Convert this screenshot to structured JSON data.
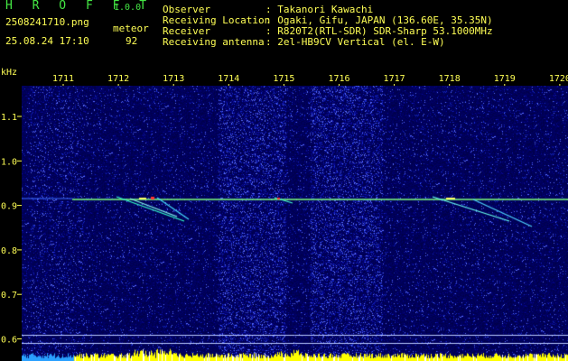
{
  "app": {
    "logo": "H R O F F T",
    "version": "1.0.0"
  },
  "file": {
    "name": "2508241710.png",
    "datetime": "25.08.24 17:10"
  },
  "detection": {
    "label": "meteor",
    "count": "92"
  },
  "station": {
    "rows": [
      {
        "label": "Observer",
        "value": ": Takanori Kawachi"
      },
      {
        "label": "Receiving Location",
        "value": ": Ogaki, Gifu, JAPAN (136.60E, 35.35N)"
      },
      {
        "label": "Receiver",
        "value": ": R820T2(RTL-SDR) SDR-Sharp 53.1000MHz"
      },
      {
        "label": "Receiving antenna",
        "value": ": 2el-HB9CV Vertical (el. E-W)"
      }
    ]
  },
  "axes": {
    "unit": "kHz",
    "time_ticks": [
      "1711",
      "1712",
      "1713",
      "1714",
      "1715",
      "1716",
      "1717",
      "1718",
      "1719",
      "1720"
    ],
    "freq_ticks": [
      "1.1",
      "1.0",
      "0.9",
      "0.8",
      "0.7",
      "0.6"
    ]
  },
  "colors": {
    "yellow": "#ffff55",
    "green": "#44e844",
    "signal": "#7cff7c",
    "background": "#000000"
  }
}
